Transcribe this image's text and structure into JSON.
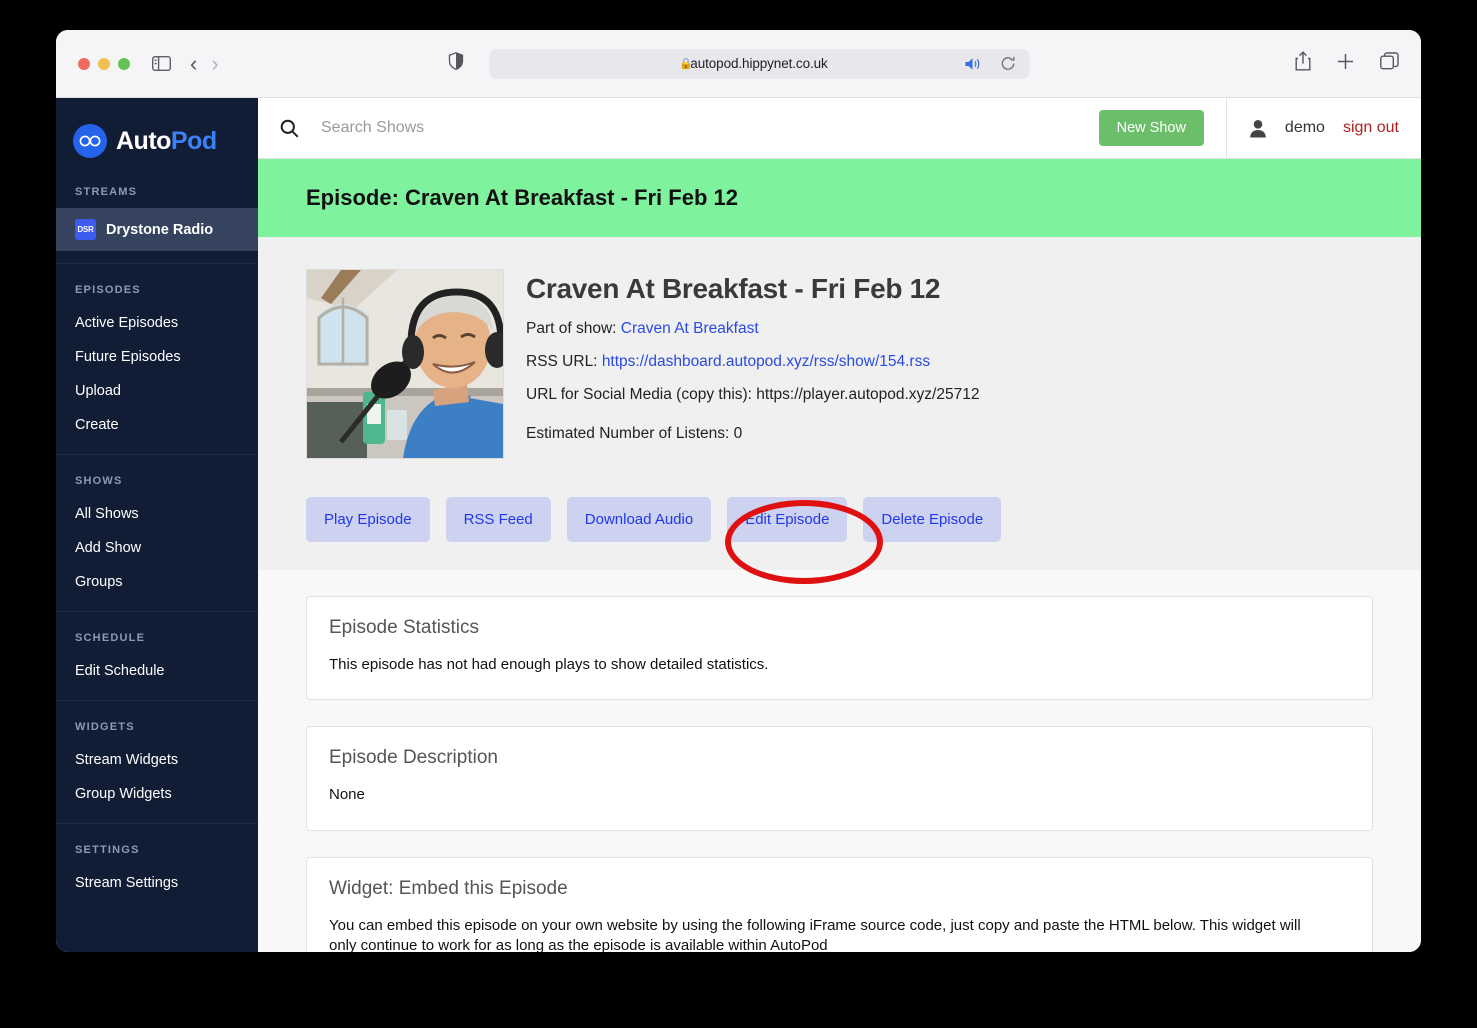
{
  "browser": {
    "url": "autopod.hippynet.co.uk",
    "lock_icon": "lock-icon",
    "shield_icon": "shield-icon",
    "reload_icon": "reload-icon",
    "audio_icon": "speaker-icon",
    "back_arrow": "‹",
    "forward_arrow": "›",
    "sidebar_toggle_icon": "sidebar-toggle-icon",
    "share_icon": "share-icon",
    "new_tab_icon": "plus-icon",
    "tabs_icon": "tabs-overview-icon"
  },
  "sidebar": {
    "brand": {
      "name_part1": "Auto",
      "name_part2": "Pod",
      "logo_icon": "binoculars-logo-icon"
    },
    "sections": [
      {
        "heading": "STREAMS",
        "items": [
          {
            "label": "Drystone Radio",
            "badge": "DSR",
            "active": true
          }
        ]
      },
      {
        "heading": "EPISODES",
        "items": [
          {
            "label": "Active Episodes"
          },
          {
            "label": "Future Episodes"
          },
          {
            "label": "Upload"
          },
          {
            "label": "Create"
          }
        ]
      },
      {
        "heading": "SHOWS",
        "items": [
          {
            "label": "All Shows"
          },
          {
            "label": "Add Show"
          },
          {
            "label": "Groups"
          }
        ]
      },
      {
        "heading": "SCHEDULE",
        "items": [
          {
            "label": "Edit Schedule"
          }
        ]
      },
      {
        "heading": "WIDGETS",
        "items": [
          {
            "label": "Stream Widgets"
          },
          {
            "label": "Group Widgets"
          }
        ]
      },
      {
        "heading": "SETTINGS",
        "items": [
          {
            "label": "Stream Settings"
          }
        ]
      }
    ]
  },
  "topbar": {
    "search_placeholder": "Search Shows",
    "search_value": "",
    "search_icon": "search-icon",
    "new_show_label": "New Show",
    "new_show_color": "#6dbe6b",
    "user_icon": "person-icon",
    "username": "demo",
    "sign_out_label": "sign out",
    "sign_out_color": "#aa2222"
  },
  "banner": {
    "title": "Episode: Craven At Breakfast - Fri Feb 12",
    "background_color": "#7ef29d"
  },
  "episode": {
    "title": "Craven At Breakfast - Fri Feb 12",
    "part_of_show_label": "Part of show:",
    "show_name": "Craven At Breakfast",
    "rss_url_label": "RSS URL:",
    "rss_url": "https://dashboard.autopod.xyz/rss/show/154.rss",
    "social_url_line": "URL for Social Media (copy this): https://player.autopod.xyz/25712",
    "listens_line": "Estimated Number of Listens: 0",
    "artwork_alt": "episode-artwork"
  },
  "actions": [
    {
      "label": "Play Episode"
    },
    {
      "label": "RSS Feed"
    },
    {
      "label": "Download Audio"
    },
    {
      "label": "Edit Episode"
    },
    {
      "label": "Delete Episode"
    }
  ],
  "annotation": {
    "shape": "ellipse",
    "color": "#e01010",
    "targets": "Download Audio"
  },
  "cards": [
    {
      "title": "Episode Statistics",
      "body": "This episode has not had enough plays to show detailed statistics."
    },
    {
      "title": "Episode Description",
      "body": "None"
    },
    {
      "title": "Widget: Embed this Episode",
      "body": "You can embed this episode on your own website by using the following iFrame source code, just copy and paste the HTML below. This widget will only continue to work for as long as the episode is available within AutoPod"
    }
  ]
}
